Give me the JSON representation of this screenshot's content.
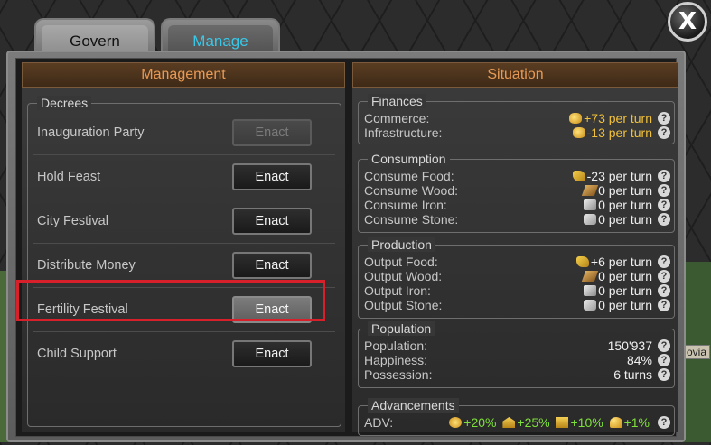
{
  "tabs": [
    {
      "label": "Govern",
      "active": false
    },
    {
      "label": "Manage",
      "active": true
    }
  ],
  "close_label": "X",
  "map_label": "ovia",
  "management": {
    "title": "Management",
    "decrees_title": "Decrees",
    "decrees": [
      {
        "label": "Inauguration Party",
        "button": "Enact",
        "state": "disabled"
      },
      {
        "label": "Hold Feast",
        "button": "Enact",
        "state": "normal"
      },
      {
        "label": "City Festival",
        "button": "Enact",
        "state": "normal"
      },
      {
        "label": "Distribute Money",
        "button": "Enact",
        "state": "normal"
      },
      {
        "label": "Fertility Festival",
        "button": "Enact",
        "state": "hover",
        "highlighted": true
      },
      {
        "label": "Child Support",
        "button": "Enact",
        "state": "normal"
      }
    ]
  },
  "situation": {
    "title": "Situation",
    "finances": {
      "title": "Finances",
      "rows": [
        {
          "label": "Commerce:",
          "value": "+73 per turn",
          "icon": "gold-coin-icon"
        },
        {
          "label": "Infrastructure:",
          "value": "-13 per turn",
          "icon": "gold-coin-icon"
        }
      ]
    },
    "consumption": {
      "title": "Consumption",
      "rows": [
        {
          "label": "Consume Food:",
          "value": "-23 per turn",
          "icon": "food-icon"
        },
        {
          "label": "Consume Wood:",
          "value": "0 per turn",
          "icon": "wood-icon"
        },
        {
          "label": "Consume Iron:",
          "value": "0 per turn",
          "icon": "iron-icon"
        },
        {
          "label": "Consume Stone:",
          "value": "0 per turn",
          "icon": "stone-icon"
        }
      ]
    },
    "production": {
      "title": "Production",
      "rows": [
        {
          "label": "Output Food:",
          "value": "+6 per turn",
          "icon": "food-icon"
        },
        {
          "label": "Output Wood:",
          "value": "0 per turn",
          "icon": "wood-icon"
        },
        {
          "label": "Output Iron:",
          "value": "0 per turn",
          "icon": "iron-icon"
        },
        {
          "label": "Output Stone:",
          "value": "0 per turn",
          "icon": "stone-icon"
        }
      ]
    },
    "population": {
      "title": "Population",
      "rows": [
        {
          "label": "Population:",
          "value": "150'937"
        },
        {
          "label": "Happiness:",
          "value": "84%"
        },
        {
          "label": "Possession:",
          "value": "6 turns"
        }
      ]
    },
    "advancements": {
      "title": "Advancements",
      "label": "ADV:",
      "values": [
        "+20%",
        "+25%",
        "+10%",
        "+1%"
      ]
    }
  },
  "help_glyph": "?",
  "colors": {
    "accent_orange": "#e89a55",
    "tab_active": "#39c8e8",
    "highlight_red": "#d8202a",
    "positive_green": "#7ee03a",
    "gold": "#f2c13a"
  }
}
